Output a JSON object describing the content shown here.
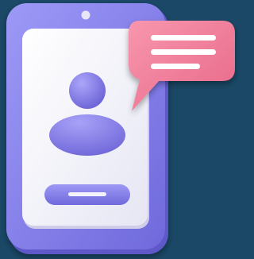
{
  "illustration": {
    "background_color": "#1a4866",
    "phone_frame_color": "#8a86f0",
    "phone_screen_color": "#f4f4fb",
    "avatar_color": "#8e86ec",
    "button_color": "#8a86ee",
    "chat_bubble_color": "#f07a9a",
    "chat_lines_color": "#ffffff",
    "icons": [
      "smartphone-icon",
      "user-avatar-icon",
      "chat-bubble-icon"
    ]
  }
}
